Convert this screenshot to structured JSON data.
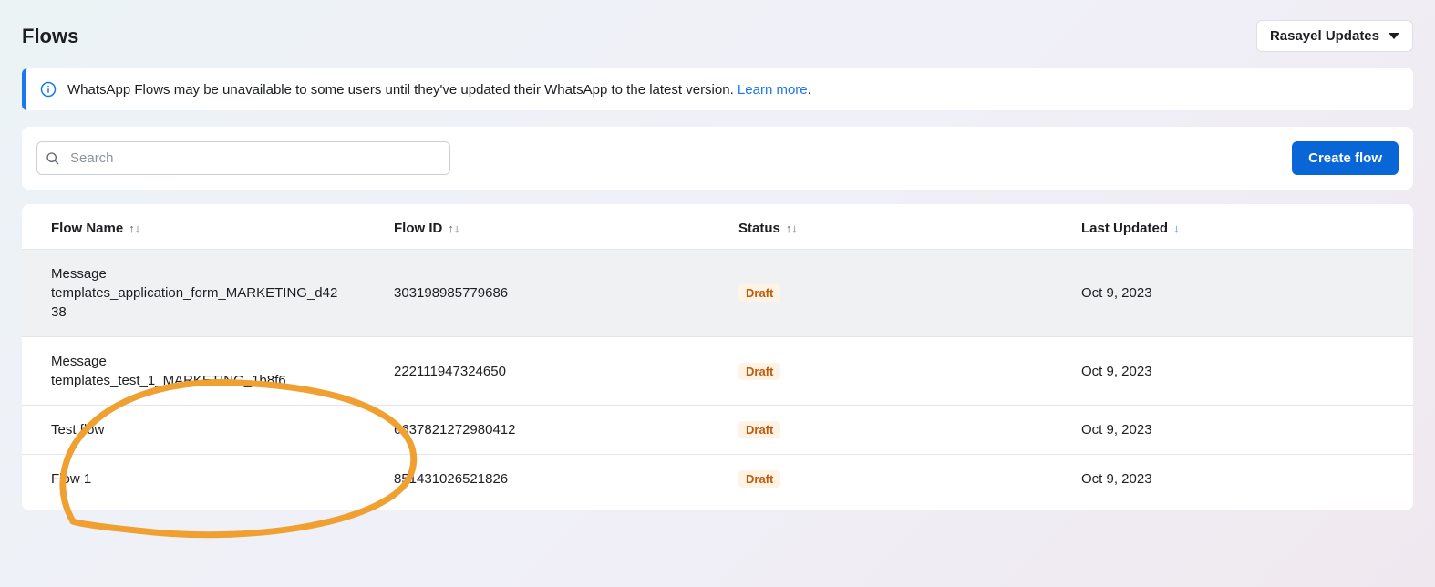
{
  "page": {
    "title": "Flows"
  },
  "account_dropdown": {
    "label": "Rasayel Updates"
  },
  "banner": {
    "text": "WhatsApp Flows may be unavailable to some users until they've updated their WhatsApp to the latest version. ",
    "link_text": "Learn more"
  },
  "search": {
    "placeholder": "Search"
  },
  "create_button": {
    "label": "Create flow"
  },
  "columns": {
    "name": "Flow Name",
    "id": "Flow ID",
    "status": "Status",
    "updated": "Last Updated"
  },
  "rows": [
    {
      "name": "Message templates_application_form_MARKETING_d4238",
      "id": "303198985779686",
      "status": "Draft",
      "updated": "Oct 9, 2023",
      "highlight": true
    },
    {
      "name": "Message templates_test_1_MARKETING_1b8f6",
      "id": "222111947324650",
      "status": "Draft",
      "updated": "Oct 9, 2023",
      "highlight": false
    },
    {
      "name": "Test flow",
      "id": "6637821272980412",
      "status": "Draft",
      "updated": "Oct 9, 2023",
      "highlight": false
    },
    {
      "name": "Flow 1",
      "id": "851431026521826",
      "status": "Draft",
      "updated": "Oct 9, 2023",
      "highlight": false
    }
  ],
  "annotation": {
    "color": "#f0a030"
  }
}
